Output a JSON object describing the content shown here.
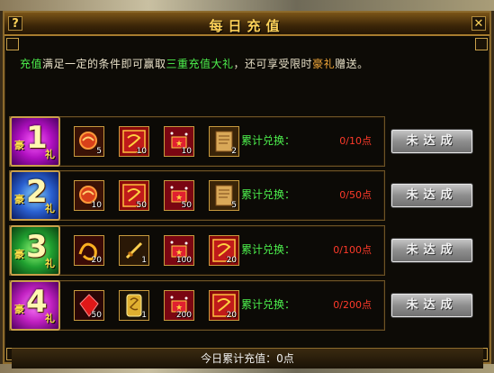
{
  "window": {
    "title": "每日充值",
    "help_btn": "?",
    "close_btn": "✕"
  },
  "intro": {
    "part1": "充值",
    "part2": "满足一定的条件即可赢取",
    "part3": "三重充值大礼",
    "part4": "，还可享受限时",
    "part5": "豪礼",
    "part6": "赠送。"
  },
  "tiers": [
    {
      "medal_prefix": "豪",
      "number": "1",
      "suffix": "礼",
      "label": "累计兑换：",
      "progress": "0/10点",
      "button": "未达成",
      "items": [
        {
          "icon": "orb-icon",
          "count": "5"
        },
        {
          "icon": "dragon-token-icon",
          "count": "10"
        },
        {
          "icon": "sparkle-chest-icon",
          "count": "10"
        },
        {
          "icon": "scroll-icon",
          "count": "2"
        }
      ]
    },
    {
      "medal_prefix": "豪",
      "number": "2",
      "suffix": "礼",
      "label": "累计兑换：",
      "progress": "0/50点",
      "button": "未达成",
      "items": [
        {
          "icon": "orb-icon",
          "count": "10"
        },
        {
          "icon": "dragon-token-icon",
          "count": "50"
        },
        {
          "icon": "sparkle-chest-icon",
          "count": "50"
        },
        {
          "icon": "scroll-icon",
          "count": "5"
        }
      ]
    },
    {
      "medal_prefix": "豪",
      "number": "3",
      "suffix": "礼",
      "label": "累计兑换：",
      "progress": "0/100点",
      "button": "未达成",
      "items": [
        {
          "icon": "gold-dragon-icon",
          "count": "20"
        },
        {
          "icon": "sword-icon",
          "count": "1"
        },
        {
          "icon": "sparkle-chest-icon",
          "count": "100"
        },
        {
          "icon": "dragon-token-icon",
          "count": "20"
        }
      ]
    },
    {
      "medal_prefix": "豪",
      "number": "4",
      "suffix": "礼",
      "label": "累计兑换：",
      "progress": "0/200点",
      "button": "未达成",
      "items": [
        {
          "icon": "red-gem-icon",
          "count": "50"
        },
        {
          "icon": "gold-talisman-icon",
          "count": "1"
        },
        {
          "icon": "sparkle-chest-icon",
          "count": "200"
        },
        {
          "icon": "dragon-token-icon",
          "count": "20"
        }
      ]
    }
  ],
  "footer": {
    "total": "今日累计充值：0点"
  },
  "colors": {
    "label_green": "#4df04d",
    "progress_red": "#ff3a2a",
    "title_gold": "#ffd35a"
  }
}
